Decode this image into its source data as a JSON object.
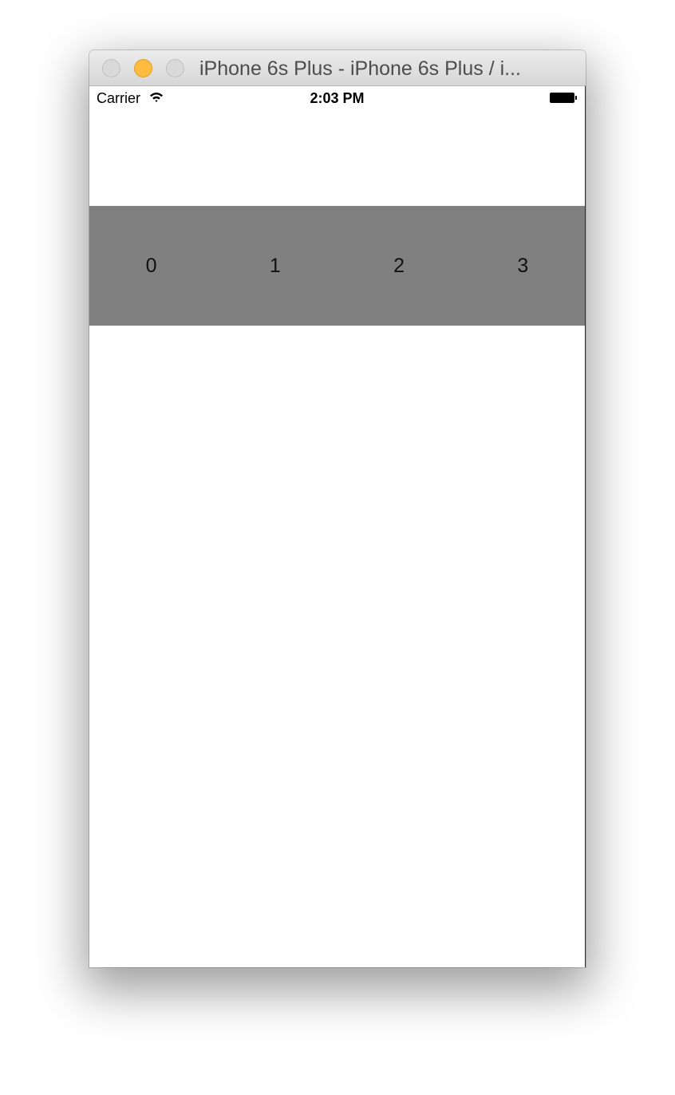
{
  "window": {
    "title": "iPhone 6s Plus - iPhone 6s Plus / i..."
  },
  "statusbar": {
    "carrier": "Carrier",
    "time": "2:03 PM",
    "wifi_icon": "wifi-icon",
    "battery_icon": "battery-icon"
  },
  "band": {
    "color": "#808080",
    "items": [
      {
        "label": "0"
      },
      {
        "label": "1"
      },
      {
        "label": "2"
      },
      {
        "label": "3"
      }
    ]
  },
  "colors": {
    "traffic_close": "#d9d9d9",
    "traffic_minimize": "#fdbc40",
    "traffic_zoom": "#d9d9d9"
  }
}
